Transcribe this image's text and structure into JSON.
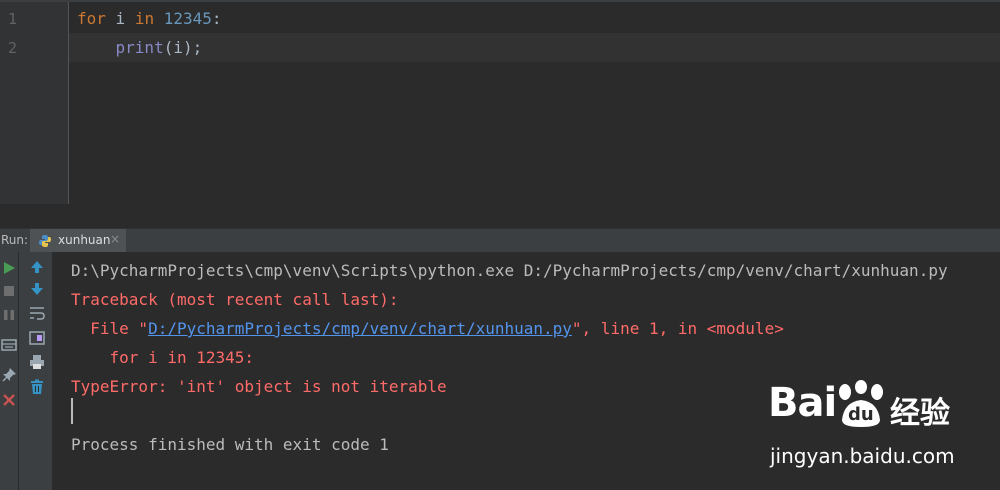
{
  "editor": {
    "line_numbers": [
      "1",
      "2"
    ],
    "line1": {
      "kw_for": "for",
      "var": " i ",
      "kw_in": "in",
      "space": " ",
      "num": "12345",
      "colon": ":"
    },
    "line2": {
      "indent": "    ",
      "fn": "print",
      "args": "(i);"
    }
  },
  "run": {
    "label": "Run:",
    "tab_label": "xunhuan",
    "tab_close": "×"
  },
  "console": {
    "command": "D:\\PycharmProjects\\cmp\\venv\\Scripts\\python.exe D:/PycharmProjects/cmp/venv/chart/xunhuan.py",
    "traceback_header": "Traceback (most recent call last):",
    "file_prefix": "  File \"",
    "file_link": "D:/PycharmProjects/cmp/venv/chart/xunhuan.py",
    "file_suffix": "\", line 1, in <module>",
    "code_line": "    for i in 12345:",
    "error": "TypeError: 'int' object is not iterable",
    "exit": "Process finished with exit code 1"
  },
  "watermark": {
    "brand": "Bai",
    "brand_du": "du",
    "jingyan": "经验",
    "url": "jingyan.baidu.com"
  },
  "colors": {
    "keyword": "#cc7832",
    "number": "#6897bb",
    "builtin": "#8888c6",
    "error_red": "#ff6b68",
    "link_blue": "#5394ec",
    "run_green": "#499c54"
  },
  "icons": [
    "run-icon",
    "stop-icon",
    "pause-icon",
    "layout-icon",
    "pin-icon",
    "close-icon",
    "up-arrow-icon",
    "down-arrow-icon",
    "soft-wrap-icon",
    "scroll-to-end-icon",
    "print-icon",
    "trash-icon",
    "python-file-icon"
  ]
}
